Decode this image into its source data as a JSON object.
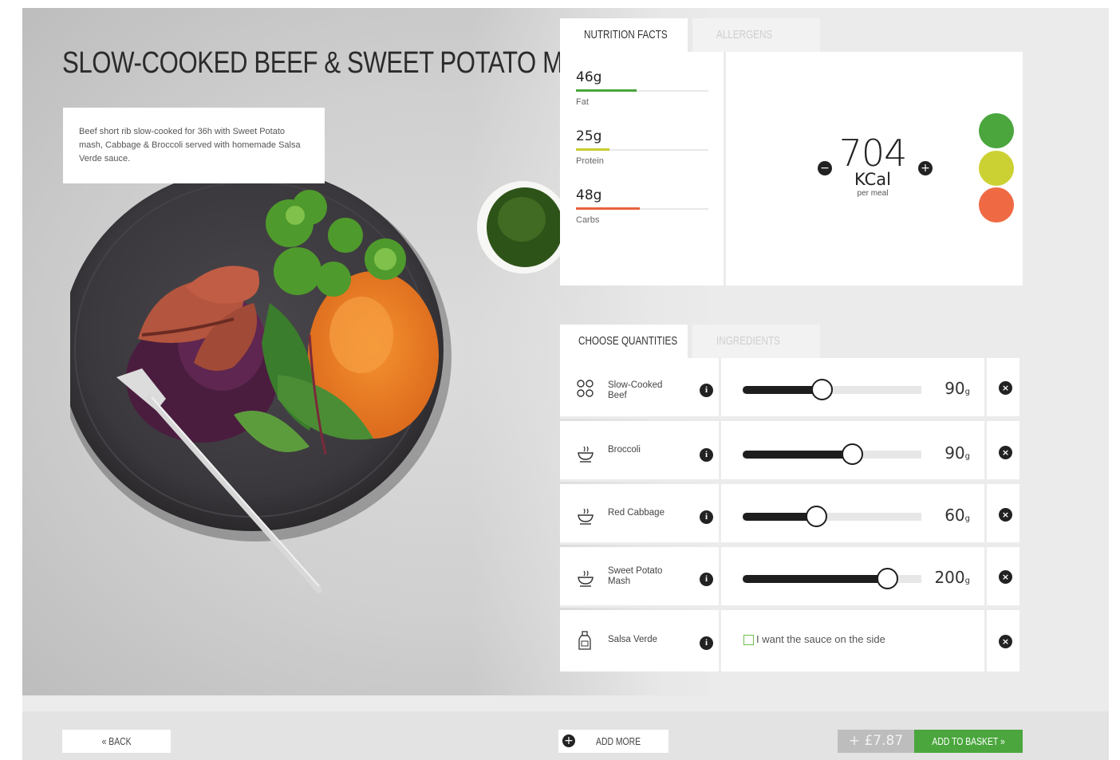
{
  "meal": {
    "title": "SLOW-COOKED BEEF & SWEET POTATO MASH",
    "description": "Beef short rib slow-cooked for 36h with Sweet Potato mash, Cabbage & Broccoli served with homemade Salsa Verde sauce."
  },
  "nutrition_tabs": {
    "active": "NUTRITION FACTS",
    "inactive": "ALLERGENS"
  },
  "macros": [
    {
      "value": "46g",
      "label": "Fat",
      "fraction": 0.46,
      "color": "#4aa63d"
    },
    {
      "value": "25g",
      "label": "Protein",
      "fraction": 0.25,
      "color": "#c8cc2e"
    },
    {
      "value": "48g",
      "label": "Carbs",
      "fraction": 0.48,
      "color": "#e8623c"
    }
  ],
  "calories": {
    "value": "704",
    "unit": "KCal",
    "per": "per meal",
    "minus_icon": "minus-circle-icon",
    "plus_icon": "plus-circle-icon"
  },
  "traffic_lights": [
    "#4aa63d",
    "#ccd133",
    "#ef6a43"
  ],
  "quantity_tabs": {
    "active": "CHOOSE QUANTITIES",
    "inactive": "INGREDIENTS"
  },
  "ingredients": [
    {
      "name": "Slow-Cooked Beef",
      "icon": "beef-icon",
      "value": "90",
      "unit": "g",
      "fraction": 0.44
    },
    {
      "name": "Broccoli",
      "icon": "bowl-icon",
      "value": "90",
      "unit": "g",
      "fraction": 0.61
    },
    {
      "name": "Red Cabbage",
      "icon": "bowl-icon",
      "value": "60",
      "unit": "g",
      "fraction": 0.41
    },
    {
      "name": "Sweet Potato Mash",
      "icon": "bowl-icon",
      "value": "200",
      "unit": "g",
      "fraction": 0.81
    }
  ],
  "sauce": {
    "name": "Salsa Verde",
    "icon": "sauce-bottle-icon",
    "checkbox_label": "I want the sauce on the side",
    "checked": false
  },
  "footer": {
    "back_label": "« BACK",
    "add_more_label": "ADD MORE",
    "price": "+ £7.87",
    "add_basket_label": "ADD TO BASKET »"
  }
}
